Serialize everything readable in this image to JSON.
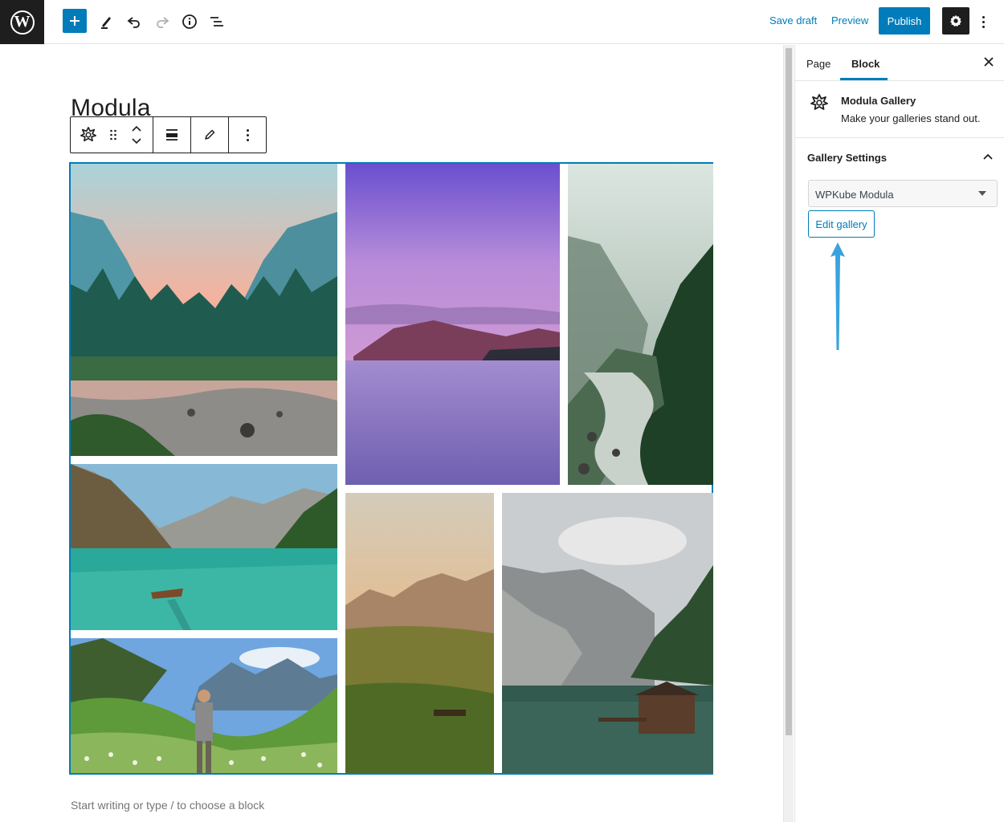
{
  "header": {
    "save_draft": "Save draft",
    "preview": "Preview",
    "publish": "Publish"
  },
  "editor": {
    "title": "Modula",
    "placeholder": "Start writing or type / to choose a block"
  },
  "sidebar": {
    "tabs": [
      {
        "label": "Page",
        "active": false
      },
      {
        "label": "Block",
        "active": true
      }
    ],
    "block": {
      "name": "Modula Gallery",
      "description": "Make your galleries stand out."
    },
    "panel": {
      "title": "Gallery Settings",
      "select_value": "WPKube Modula",
      "edit_button": "Edit gallery"
    }
  },
  "icons": [
    "wordpress-logo-icon",
    "plus-icon",
    "pencil-icon",
    "undo-icon",
    "redo-icon",
    "info-icon",
    "list-view-icon",
    "gear-icon",
    "more-vertical-icon",
    "close-icon",
    "modula-icon",
    "chevron-up-icon",
    "drag-handle-icon",
    "align-icon"
  ],
  "colors": {
    "accent": "#007cba",
    "dark": "#1e1e1e",
    "annotation_arrow": "#3aa3dc"
  }
}
